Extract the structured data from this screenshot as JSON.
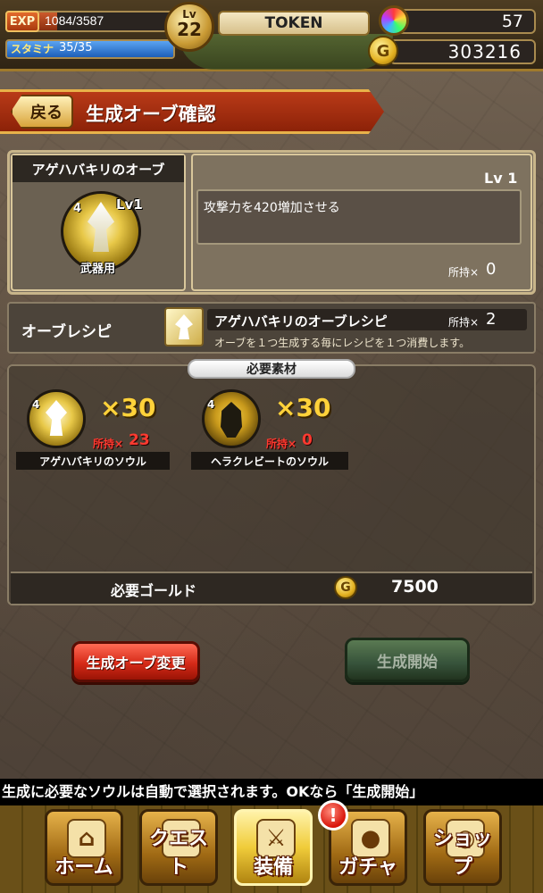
{
  "status": {
    "exp_tag": "EXP",
    "exp_current": 1084,
    "exp_max": 3587,
    "exp_text": "1084/3587",
    "stamina_label": "スタミナ",
    "stamina_text": "35/35",
    "stamina_fraction": 1.0,
    "level_label": "Lv",
    "level": "22",
    "token": "TOKEN",
    "gems": "57",
    "gold": "303216",
    "gold_icon": "G"
  },
  "header": {
    "back_label": "戻る",
    "title": "生成オーブ確認"
  },
  "orb": {
    "name": "アゲハバキリのオーブ",
    "level": "Lv1",
    "rarity": "4",
    "type": "武器用",
    "detail_level": "Lv 1",
    "effect": "攻撃力を420増加させる",
    "owned_label": "所持×",
    "owned_value": "0"
  },
  "recipe": {
    "label": "オーブレシピ",
    "name": "アゲハバキリのオーブレシピ",
    "owned_label": "所持×",
    "owned_value": "2",
    "description": "オーブを１つ生成する毎にレシピを１つ消費します。"
  },
  "materials": {
    "tab_label": "必要素材",
    "items": [
      {
        "name": "アゲハバキリのソウル",
        "rarity": "4",
        "qty": "×30",
        "owned_label": "所持×",
        "owned_value": "23"
      },
      {
        "name": "ヘラクレビートのソウル",
        "rarity": "4",
        "qty": "×30",
        "owned_label": "所持×",
        "owned_value": "0"
      }
    ],
    "gold_label": "必要ゴールド",
    "gold_icon": "G",
    "gold_value": "7500"
  },
  "actions": {
    "change_label": "生成オーブ変更",
    "start_label": "生成開始"
  },
  "ticker": "生成に必要なソウルは自動で選択されます。OKなら「生成開始」",
  "nav": {
    "alert": "!",
    "items": [
      {
        "label": "ホーム",
        "icon": "home-icon",
        "glyph": "⌂"
      },
      {
        "label": "クエスト",
        "icon": "quest-icon",
        "glyph": "≡"
      },
      {
        "label": "装備",
        "icon": "equipment-icon",
        "glyph": "⚔"
      },
      {
        "label": "ガチャ",
        "icon": "gacha-icon",
        "glyph": "●"
      },
      {
        "label": "ショップ",
        "icon": "shop-icon",
        "glyph": "◉"
      }
    ]
  }
}
